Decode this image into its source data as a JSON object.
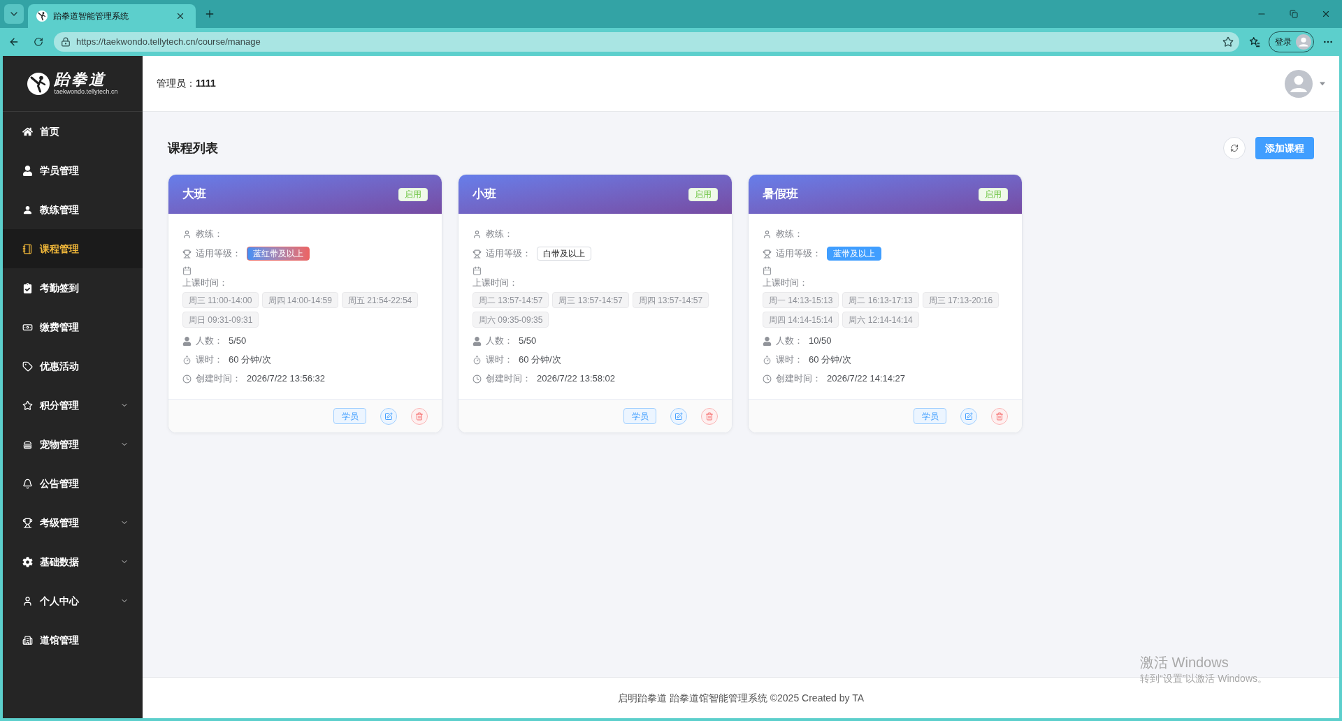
{
  "browser": {
    "tab_title": "跆拳道智能管理系统",
    "url": "https://taekwondo.tellytech.cn/course/manage",
    "profile_button": "登录"
  },
  "sidebar": {
    "logo_title": "跆拳道",
    "logo_subtitle": "taekwondo.tellytech.cn",
    "items": [
      {
        "label": "首页",
        "kind": "link",
        "selected": false
      },
      {
        "label": "学员管理",
        "kind": "link",
        "selected": false
      },
      {
        "label": "教练管理",
        "kind": "link",
        "selected": false
      },
      {
        "label": "课程管理",
        "kind": "link",
        "selected": true
      },
      {
        "label": "考勤签到",
        "kind": "link",
        "selected": false
      },
      {
        "label": "缴费管理",
        "kind": "link",
        "selected": false
      },
      {
        "label": "优惠活动",
        "kind": "link",
        "selected": false
      },
      {
        "label": "积分管理",
        "kind": "submenu",
        "selected": false,
        "expanded": false
      },
      {
        "label": "宠物管理",
        "kind": "submenu",
        "selected": false,
        "expanded": false
      },
      {
        "label": "公告管理",
        "kind": "link",
        "selected": false
      },
      {
        "label": "考级管理",
        "kind": "submenu",
        "selected": false,
        "expanded": false
      },
      {
        "label": "基础数据",
        "kind": "submenu",
        "selected": false,
        "expanded": false
      },
      {
        "label": "个人中心",
        "kind": "submenu",
        "selected": false,
        "expanded": false
      },
      {
        "label": "道馆管理",
        "kind": "link",
        "selected": false
      }
    ]
  },
  "header": {
    "admin": "管理员：**1111**"
  },
  "page": {
    "title": "课程列表",
    "add_button": "添加课程"
  },
  "courses": [
    {
      "name": "大班",
      "status": "启用",
      "coach_label": "教练：",
      "level_label": "适用等级：",
      "level": {
        "text": "蓝红带及以上",
        "kind": "gradient"
      },
      "schedule_label": "上课时间：",
      "schedule": [
        "周三 11:00-14:00",
        "周四 14:00-14:59",
        "周五 21:54-22:54",
        "周日 09:31-09:31"
      ],
      "count_label": "人数：",
      "count": "5/50",
      "duration_label": "课时：",
      "duration": "60 分钟/次",
      "created_label": "创建时间：",
      "created": "2026/7/22 13:56:32",
      "students_button": "学员"
    },
    {
      "name": "小班",
      "status": "启用",
      "coach_label": "教练：",
      "level_label": "适用等级：",
      "level": {
        "text": "白带及以上",
        "kind": "outline"
      },
      "schedule_label": "上课时间：",
      "schedule": [
        "周二 13:57-14:57",
        "周三 13:57-14:57",
        "周四 13:57-14:57",
        "周六 09:35-09:35"
      ],
      "count_label": "人数：",
      "count": "5/50",
      "duration_label": "课时：",
      "duration": "60 分钟/次",
      "created_label": "创建时间：",
      "created": "2026/7/22 13:58:02",
      "students_button": "学员"
    },
    {
      "name": "暑假班",
      "status": "启用",
      "coach_label": "教练：",
      "level_label": "适用等级：",
      "level": {
        "text": "蓝带及以上",
        "kind": "solid"
      },
      "schedule_label": "上课时间：",
      "schedule": [
        "周一 14:13-15:13",
        "周二 16:13-17:13",
        "周三 17:13-20:16",
        "周四 14:14-15:14",
        "周六 12:14-14:14"
      ],
      "count_label": "人数：",
      "count": "10/50",
      "duration_label": "课时：",
      "duration": "60 分钟/次",
      "created_label": "创建时间：",
      "created": "2026/7/22 14:14:27",
      "students_button": "学员"
    }
  ],
  "footer": {
    "text": "启明跆拳道 跆拳道馆智能管理系统 ©2025 Created by TA"
  },
  "os_watermark": {
    "title": "激活 Windows",
    "subtitle": "转到“设置”以激活 Windows。"
  }
}
